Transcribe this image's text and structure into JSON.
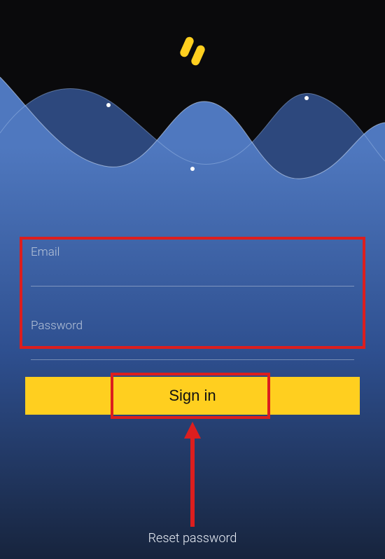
{
  "colors": {
    "accent": "#ffcf1f",
    "annotation": "#dc1e1e",
    "bg_dark": "#0a0a0c",
    "wave_light": "#5f88c8",
    "wave_dark": "#2a4e90"
  },
  "logo": {
    "name": "app-logo-icon"
  },
  "form": {
    "email": {
      "label": "Email",
      "value": ""
    },
    "password": {
      "label": "Password",
      "value": ""
    }
  },
  "buttons": {
    "signin": "Sign in"
  },
  "links": {
    "reset": "Reset password"
  }
}
